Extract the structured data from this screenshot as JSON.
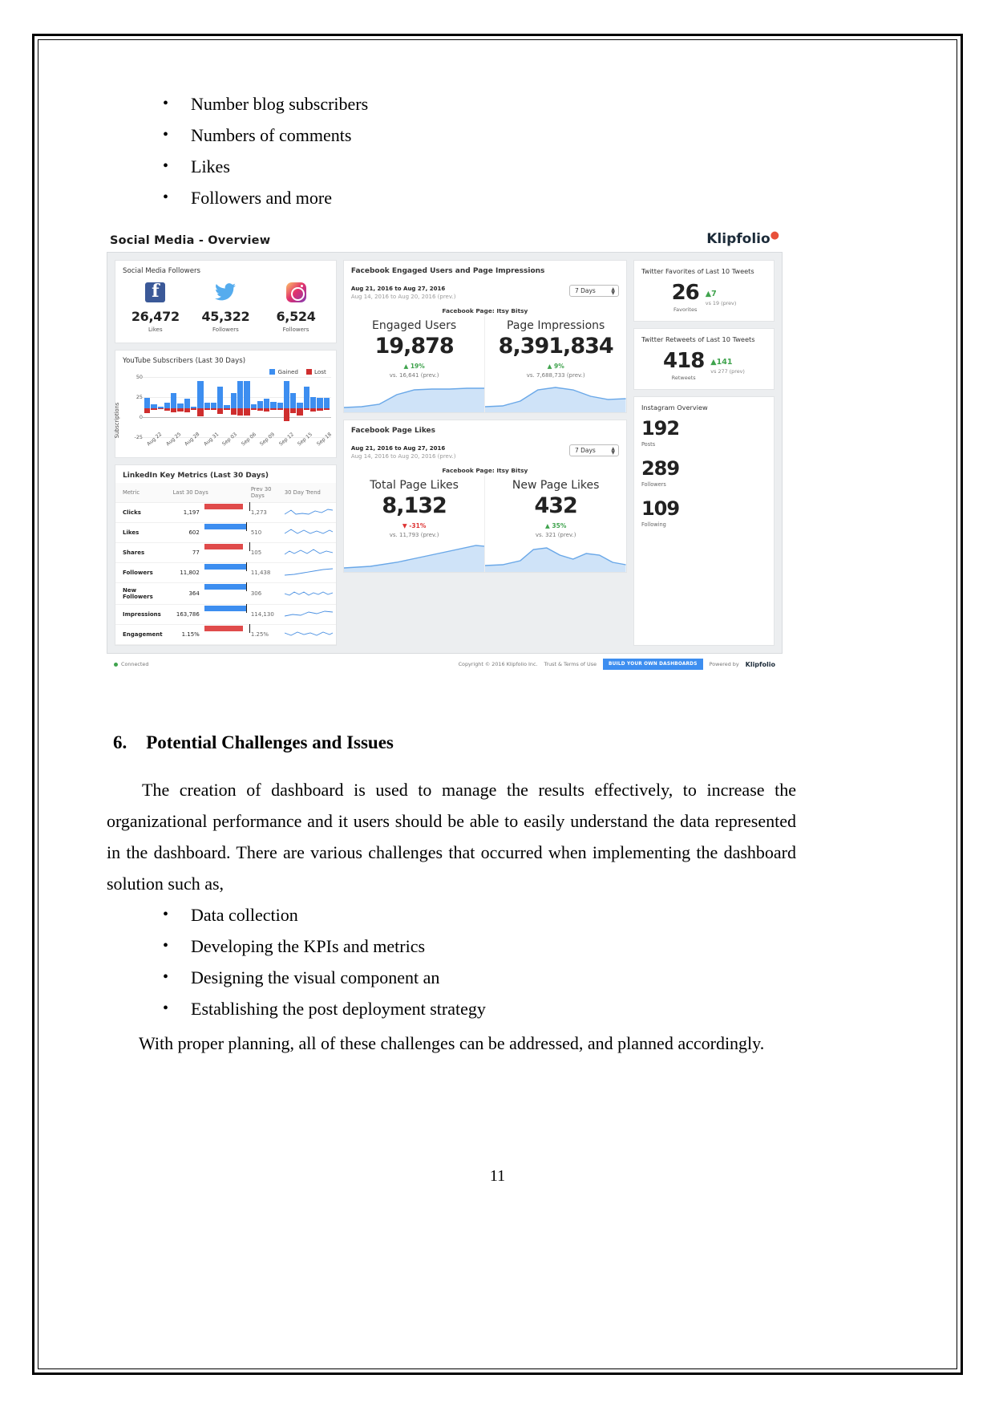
{
  "top_list": [
    "Number blog subscribers",
    "Numbers of comments",
    "Likes",
    "Followers and more"
  ],
  "dashboard": {
    "title": "Social Media - Overview",
    "brand": "Klipfolio",
    "followers_card": {
      "title": "Social Media Followers",
      "items": [
        {
          "icon": "facebook-icon",
          "value": "26,472",
          "label": "Likes"
        },
        {
          "icon": "twitter-icon",
          "value": "45,322",
          "label": "Followers"
        },
        {
          "icon": "instagram-icon",
          "value": "6,524",
          "label": "Followers"
        }
      ]
    },
    "youtube_card": {
      "title": "YouTube Subscribers (Last 30 Days)",
      "legend": [
        "Gained",
        "Lost"
      ],
      "ylabel": "Subscriptions",
      "yticks": [
        "50",
        "25",
        "0",
        "-25"
      ],
      "xticks": [
        "Aug 22",
        "Aug 25",
        "Aug 28",
        "Aug 31",
        "Sep 03",
        "Sep 06",
        "Sep 09",
        "Sep 12",
        "Sep 15",
        "Sep 18"
      ]
    },
    "linkedin_card": {
      "title": "LinkedIn Key Metrics (Last 30 Days)",
      "columns": [
        "Metric",
        "Last 30 Days",
        "Prev 30 Days",
        "30 Day Trend"
      ],
      "rows": [
        {
          "metric": "Clicks",
          "last": "1,197",
          "prev": "1,273",
          "dir": "down"
        },
        {
          "metric": "Likes",
          "last": "602",
          "prev": "510",
          "dir": "up"
        },
        {
          "metric": "Shares",
          "last": "77",
          "prev": "105",
          "dir": "down"
        },
        {
          "metric": "Followers",
          "last": "11,802",
          "prev": "11,438",
          "dir": "up"
        },
        {
          "metric": "New Followers",
          "last": "364",
          "prev": "306",
          "dir": "up"
        },
        {
          "metric": "Impressions",
          "last": "163,786",
          "prev": "114,130",
          "dir": "up"
        },
        {
          "metric": "Engagement",
          "last": "1.15%",
          "prev": "1.25%",
          "dir": "down"
        }
      ]
    },
    "fb_engaged_card": {
      "title": "Facebook Engaged Users and Page Impressions",
      "date_current": "Aug 21, 2016 to Aug 27, 2016",
      "date_previous": "Aug 14, 2016 to Aug 20, 2016 (prev.)",
      "range_select": "7 Days",
      "page_label": "Facebook Page: Itsy Bitsy",
      "metrics": [
        {
          "name": "Engaged Users",
          "value": "19,878",
          "delta": "19%",
          "dir": "up",
          "prev": "vs. 16,641 (prev.)"
        },
        {
          "name": "Page Impressions",
          "value": "8,391,834",
          "delta": "9%",
          "dir": "up",
          "prev": "vs. 7,688,733 (prev.)"
        }
      ]
    },
    "fb_likes_card": {
      "title": "Facebook Page Likes",
      "date_current": "Aug 21, 2016 to Aug 27, 2016",
      "date_previous": "Aug 14, 2016 to Aug 20, 2016 (prev.)",
      "range_select": "7 Days",
      "page_label": "Facebook Page: Itsy Bitsy",
      "metrics": [
        {
          "name": "Total Page Likes",
          "value": "8,132",
          "delta": "-31%",
          "dir": "down",
          "prev": "vs. 11,793 (prev.)"
        },
        {
          "name": "New Page Likes",
          "value": "432",
          "delta": "35%",
          "dir": "up",
          "prev": "vs. 321 (prev.)"
        }
      ]
    },
    "twitter_favorites_card": {
      "title": "Twitter Favorites of Last 10 Tweets",
      "value": "26",
      "label": "Favorites",
      "delta": "7",
      "prev": "vs 19 (prev)"
    },
    "twitter_retweets_card": {
      "title": "Twitter Retweets of Last 10 Tweets",
      "value": "418",
      "label": "Retweets",
      "delta": "141",
      "prev": "vs 277 (prev)"
    },
    "instagram_card": {
      "title": "Instagram Overview",
      "stats": [
        {
          "value": "192",
          "label": "Posts"
        },
        {
          "value": "289",
          "label": "Followers"
        },
        {
          "value": "109",
          "label": "Following"
        }
      ]
    },
    "footer": {
      "status": "Connected",
      "copyright": "Copyright © 2016 Klipfolio Inc.",
      "terms": "Trust & Terms of Use",
      "cta": "BUILD YOUR OWN DASHBOARDS",
      "powered_by": "Powered by",
      "brand": "Klipfolio"
    },
    "colors": {
      "accent_blue": "#3d8ef0",
      "red": "#cf2e2e",
      "green": "#3fa34d",
      "facebook": "#3b5998",
      "twitter": "#55acee"
    }
  },
  "section": {
    "number": "6.",
    "heading": "Potential Challenges and Issues",
    "paragraph": "The creation of dashboard is used to manage the results effectively, to increase the organizational performance and it users should be able to easily understand the data represented in the dashboard. There are various challenges that occurred when implementing the dashboard solution such as,",
    "challenges": [
      "Data collection",
      "Developing the KPIs and metrics",
      "Designing the visual component an",
      "Establishing the post deployment strategy"
    ],
    "closing": "With proper planning, all of these challenges can be addressed, and planned accordingly."
  },
  "page_number": "11"
}
